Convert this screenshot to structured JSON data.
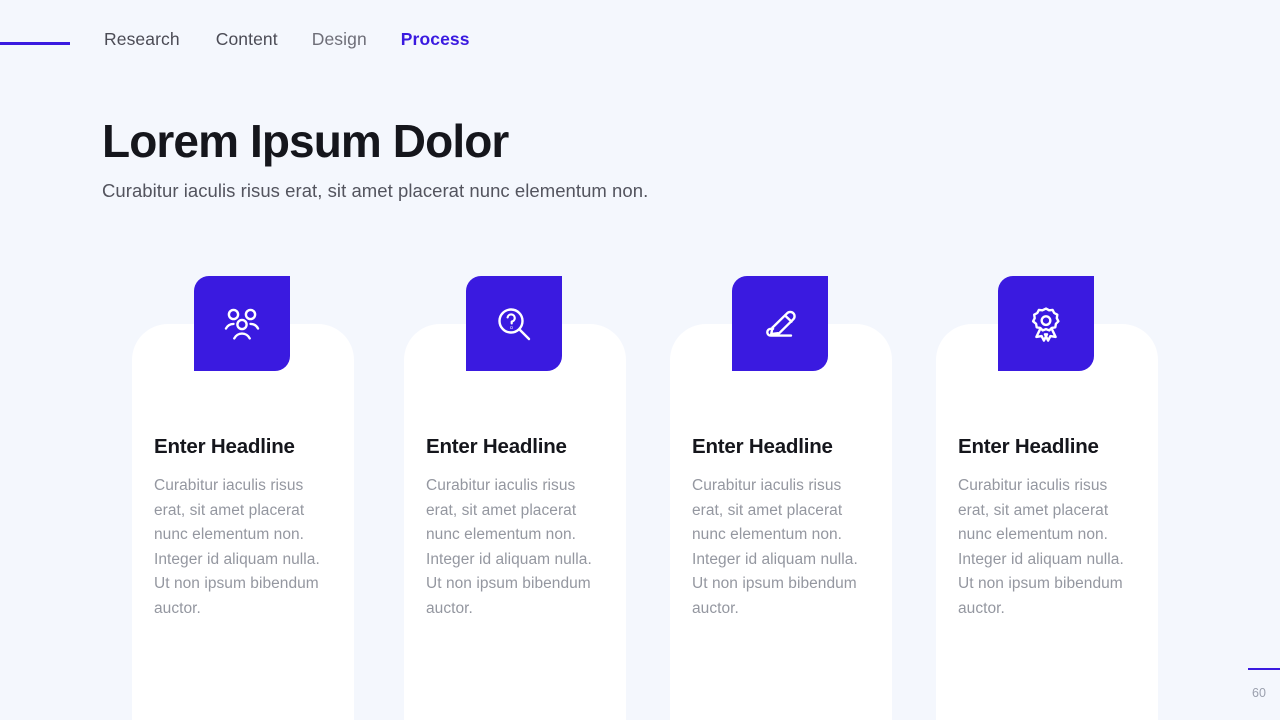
{
  "theme": {
    "background": "#f4f7fd",
    "accent": "#3a1ae0",
    "card_background": "#ffffff",
    "title_color": "#15161c",
    "body_text_color": "#9497a0"
  },
  "nav": {
    "rule": "accent-rule",
    "items": [
      {
        "label": "Research",
        "active": false
      },
      {
        "label": "Content",
        "active": false
      },
      {
        "label": "Design",
        "active": false
      },
      {
        "label": "Process",
        "active": true
      }
    ]
  },
  "header": {
    "title": "Lorem Ipsum Dolor",
    "subtitle": "Curabitur iaculis risus erat, sit amet placerat nunc elementum non."
  },
  "cards": [
    {
      "icon": "users-group-icon",
      "headline": "Enter Headline",
      "body": "Curabitur iaculis risus erat, sit amet placerat nunc elementum non. Integer id aliquam nulla. Ut non ipsum bibendum auctor."
    },
    {
      "icon": "magnifier-question-icon",
      "headline": "Enter Headline",
      "body": "Curabitur iaculis risus erat, sit amet placerat nunc elementum non. Integer id aliquam nulla. Ut non ipsum bibendum auctor."
    },
    {
      "icon": "pencil-write-icon",
      "headline": "Enter Headline",
      "body": "Curabitur iaculis risus erat, sit amet placerat nunc elementum non. Integer id aliquam nulla. Ut non ipsum bibendum auctor."
    },
    {
      "icon": "award-badge-icon",
      "headline": "Enter Headline",
      "body": "Curabitur iaculis risus erat, sit amet placerat nunc elementum non. Integer id aliquam nulla. Ut non ipsum bibendum auctor."
    }
  ],
  "footer": {
    "page_number": "60"
  }
}
